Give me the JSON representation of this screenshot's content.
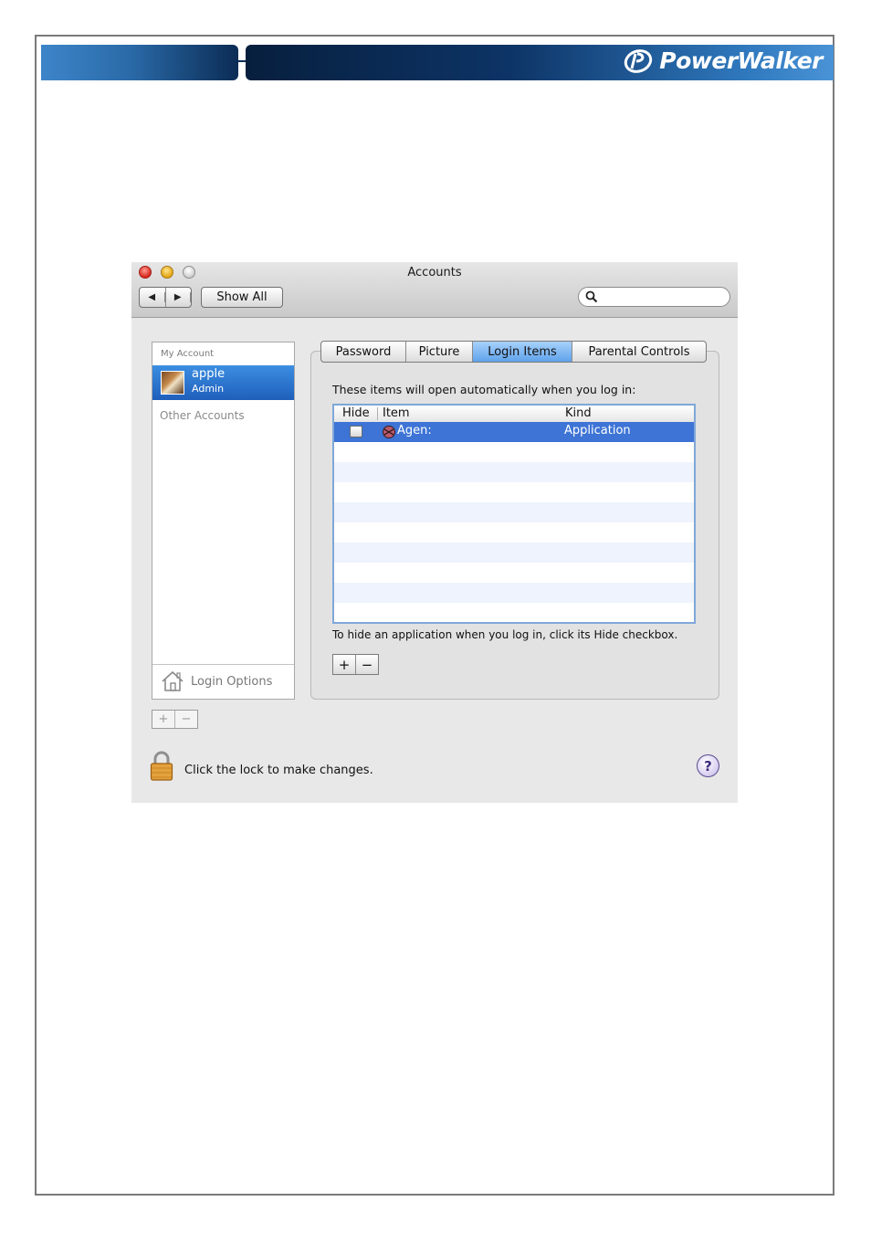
{
  "brand": {
    "name": "PowerWalker",
    "color": "#ffffff",
    "accent": "#0d3466"
  },
  "window": {
    "title": "Accounts",
    "show_all": "Show All",
    "search_placeholder": ""
  },
  "sidebar": {
    "my_account_header": "My Account",
    "user": {
      "name": "apple",
      "role": "Admin"
    },
    "other_accounts_header": "Other Accounts",
    "login_options": "Login Options",
    "add": "+",
    "remove": "−"
  },
  "tabs": [
    {
      "label": "Password",
      "active": false
    },
    {
      "label": "Picture",
      "active": false
    },
    {
      "label": "Login Items",
      "active": true
    },
    {
      "label": "Parental Controls",
      "active": false
    }
  ],
  "login_items": {
    "description": "These items will open automatically when you log in:",
    "columns": [
      "Hide",
      "Item",
      "Kind"
    ],
    "rows": [
      {
        "hide": false,
        "item": "Agen:",
        "kind": "Application"
      }
    ],
    "hint": "To hide an application when you log in, click its Hide checkbox.",
    "add": "+",
    "remove": "−"
  },
  "footer": {
    "lock_text": "Click the lock to make changes.",
    "help": "?"
  },
  "colors": {
    "selection": "#3d74d5",
    "tab_active": "#5fa2ea"
  }
}
